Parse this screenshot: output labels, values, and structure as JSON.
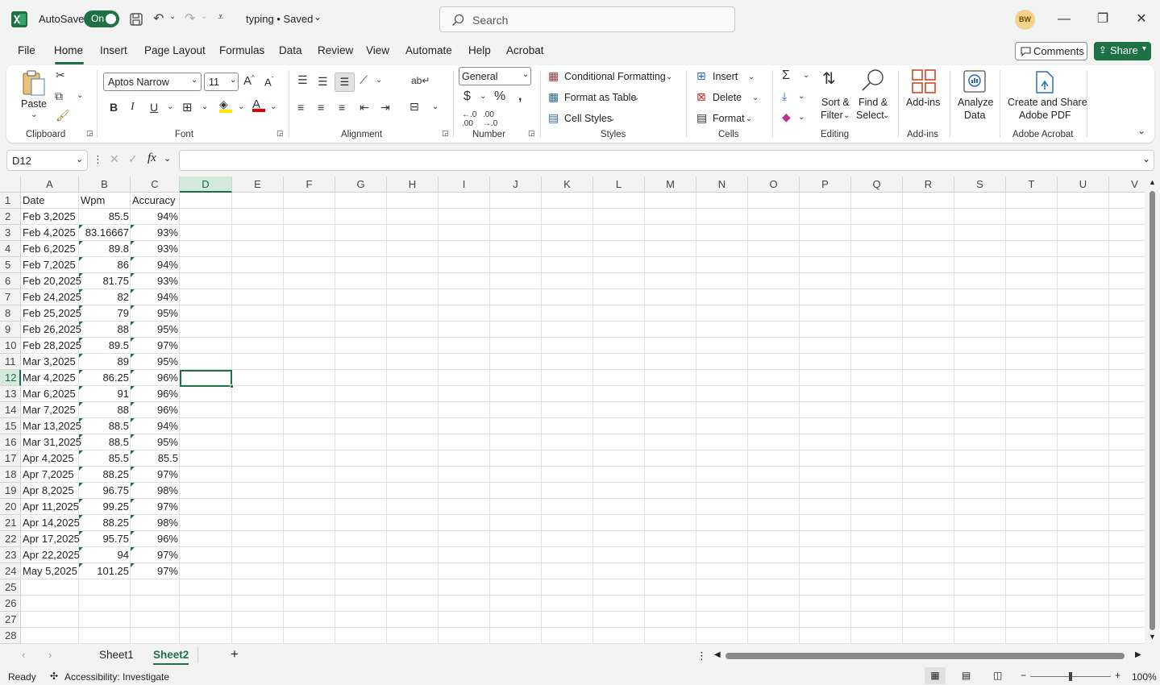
{
  "titlebar": {
    "autosave_label": "AutoSave",
    "autosave_state": "On",
    "doc_title": "typing • Saved",
    "search_placeholder": "Search",
    "user_initials": "BW",
    "accent": "#1e7145"
  },
  "menu": {
    "tabs": [
      "File",
      "Home",
      "Insert",
      "Page Layout",
      "Formulas",
      "Data",
      "Review",
      "View",
      "Automate",
      "Help",
      "Acrobat"
    ],
    "active": "Home",
    "comments_label": "Comments",
    "share_label": "Share"
  },
  "ribbon": {
    "clipboard": {
      "paste_label": "Paste",
      "group_label": "Clipboard"
    },
    "font": {
      "font_name": "Aptos Narrow",
      "font_size": "11",
      "group_label": "Font",
      "bold": "B",
      "italic": "I",
      "underline": "U"
    },
    "alignment": {
      "group_label": "Alignment"
    },
    "number": {
      "format": "General",
      "group_label": "Number"
    },
    "styles": {
      "conditional": "Conditional Formatting",
      "format_table": "Format as Table",
      "cell_styles": "Cell Styles",
      "group_label": "Styles"
    },
    "cells": {
      "insert": "Insert",
      "delete": "Delete",
      "format": "Format",
      "group_label": "Cells"
    },
    "editing": {
      "sort_1": "Sort &",
      "sort_2": "Filter",
      "find_1": "Find &",
      "find_2": "Select",
      "group_label": "Editing"
    },
    "addins": {
      "label": "Add-ins",
      "group_label": "Add-ins"
    },
    "analyze": {
      "line1": "Analyze",
      "line2": "Data"
    },
    "acrobat": {
      "line1": "Create and Share",
      "line2": "Adobe PDF",
      "group_label": "Adobe Acrobat"
    }
  },
  "formula_bar": {
    "name_box": "D12",
    "fx": "fx",
    "value": ""
  },
  "columns": [
    "A",
    "B",
    "C",
    "D",
    "E",
    "F",
    "G",
    "H",
    "I",
    "J",
    "K",
    "L",
    "M",
    "N",
    "O",
    "P",
    "Q",
    "R",
    "S",
    "T",
    "U",
    "V"
  ],
  "selected_col": "D",
  "selected_row": 12,
  "rows": [
    "1",
    "2",
    "3",
    "4",
    "5",
    "6",
    "7",
    "8",
    "9",
    "10",
    "11",
    "12",
    "13",
    "14",
    "15",
    "16",
    "17",
    "18",
    "19",
    "20",
    "21",
    "22",
    "23",
    "24",
    "25",
    "26",
    "27",
    "28"
  ],
  "table": {
    "headers": [
      "Date",
      "Wpm",
      "Accuracy"
    ],
    "data": [
      [
        "Feb 3,2025",
        "85.5",
        "94%"
      ],
      [
        "Feb 4,2025",
        "83.16667",
        "93%"
      ],
      [
        "Feb 6,2025",
        "89.8",
        "93%"
      ],
      [
        "Feb 7,2025",
        "86",
        "94%"
      ],
      [
        "Feb 20,2025",
        "81.75",
        "93%"
      ],
      [
        "Feb 24,2025",
        "82",
        "94%"
      ],
      [
        "Feb 25,2025",
        "79",
        "95%"
      ],
      [
        "Feb 26,2025",
        "88",
        "95%"
      ],
      [
        "Feb 28,2025",
        "89.5",
        "97%"
      ],
      [
        "Mar 3,2025",
        "89",
        "95%"
      ],
      [
        "Mar 4,2025",
        "86.25",
        "96%"
      ],
      [
        "Mar 6,2025",
        "91",
        "96%"
      ],
      [
        "Mar 7,2025",
        "88",
        "96%"
      ],
      [
        "Mar 13,2025",
        "88.5",
        "94%"
      ],
      [
        "Mar 31,2025",
        "88.5",
        "95%"
      ],
      [
        "Apr 4,2025",
        "85.5",
        "85.5"
      ],
      [
        "Apr 7,2025",
        "88.25",
        "97%"
      ],
      [
        "Apr 8,2025",
        "96.75",
        "98%"
      ],
      [
        "Apr 11,2025",
        "99.25",
        "97%"
      ],
      [
        "Apr 14,2025",
        "88.25",
        "98%"
      ],
      [
        "Apr 17,2025",
        "95.75",
        "96%"
      ],
      [
        "Apr 22,2025",
        "94",
        "97%"
      ],
      [
        "May 5,2025",
        "101.25",
        "97%"
      ]
    ]
  },
  "sheets": {
    "sheet1": "Sheet1",
    "sheet2": "Sheet2",
    "active": "Sheet2"
  },
  "status": {
    "ready": "Ready",
    "accessibility": "Accessibility: Investigate",
    "zoom": "100%"
  }
}
